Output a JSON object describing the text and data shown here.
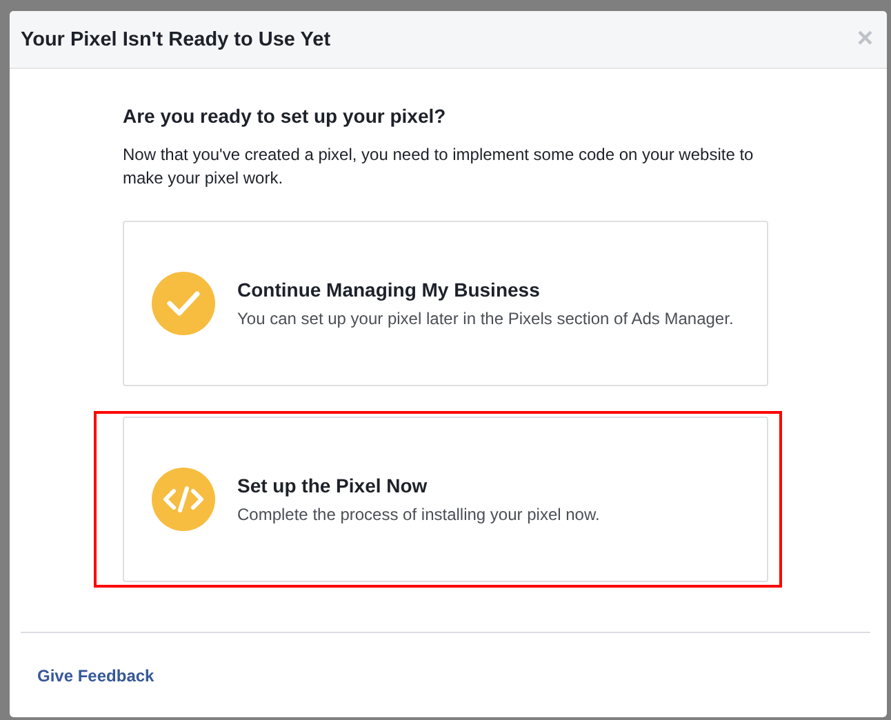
{
  "dialog": {
    "title": "Your Pixel Isn't Ready to Use Yet",
    "close_icon": "×"
  },
  "question": "Are you ready to set up your pixel?",
  "intro": "Now that you've created a pixel, you need to implement some code on your website to make your pixel work.",
  "options": [
    {
      "kind": "check",
      "title": "Continue Managing My Business",
      "description": "You can set up your pixel later in the Pixels section of Ads Manager.",
      "highlighted": false
    },
    {
      "kind": "code",
      "title": "Set up the Pixel Now",
      "description": "Complete the process of installing your pixel now.",
      "highlighted": true
    }
  ],
  "footer_link": "Give Feedback"
}
